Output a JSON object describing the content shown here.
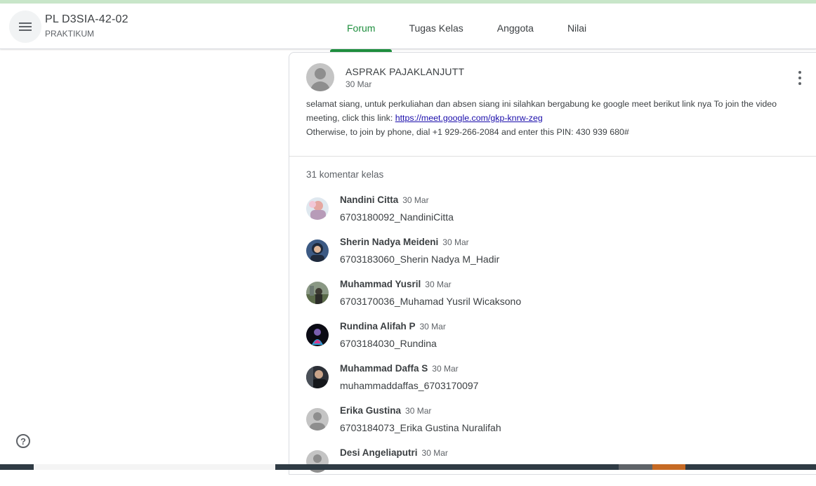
{
  "header": {
    "class_title": "PL D3SIA-42-02",
    "class_subtitle": "PRAKTIKUM",
    "menu_icon": "hamburger-menu-icon",
    "tabs": [
      {
        "label": "Forum",
        "active": true
      },
      {
        "label": "Tugas Kelas",
        "active": false
      },
      {
        "label": "Anggota",
        "active": false
      },
      {
        "label": "Nilai",
        "active": false
      }
    ]
  },
  "colors": {
    "accent": "#1e8e3e",
    "link": "#1a0dab"
  },
  "help_icon": "?",
  "post": {
    "author": "ASPRAK PAJAKLANJUTT",
    "date": "30 Mar",
    "body_line1": "selamat siang, untuk perkuliahan dan absen siang ini silahkan bergabung ke google meet berikut link nya To join the video meeting, click this link: ",
    "link_text": "https://meet.google.com/gkp-knrw-zeg",
    "body_line2": "Otherwise, to join by phone, dial +1 929-266-2084 and enter this PIN: 430 939 680#"
  },
  "comments_count": "31 komentar kelas",
  "comments": [
    {
      "name": "Nandini Citta",
      "date": "30 Mar",
      "text": "6703180092_NandiniCitta"
    },
    {
      "name": "Sherin Nadya Meideni",
      "date": "30 Mar",
      "text": "6703183060_Sherin Nadya M_Hadir"
    },
    {
      "name": "Muhammad Yusril",
      "date": "30 Mar",
      "text": "6703170036_Muhamad Yusril Wicaksono"
    },
    {
      "name": "Rundina Alifah P",
      "date": "30 Mar",
      "text": "6703184030_Rundina"
    },
    {
      "name": "Muhammad Daffa S",
      "date": "30 Mar",
      "text": "muhammaddaffas_6703170097"
    },
    {
      "name": "Erika Gustina",
      "date": "30 Mar",
      "text": "6703184073_Erika Gustina Nuralifah"
    },
    {
      "name": "Desi Angeliaputri",
      "date": "30 Mar",
      "text": ""
    }
  ]
}
